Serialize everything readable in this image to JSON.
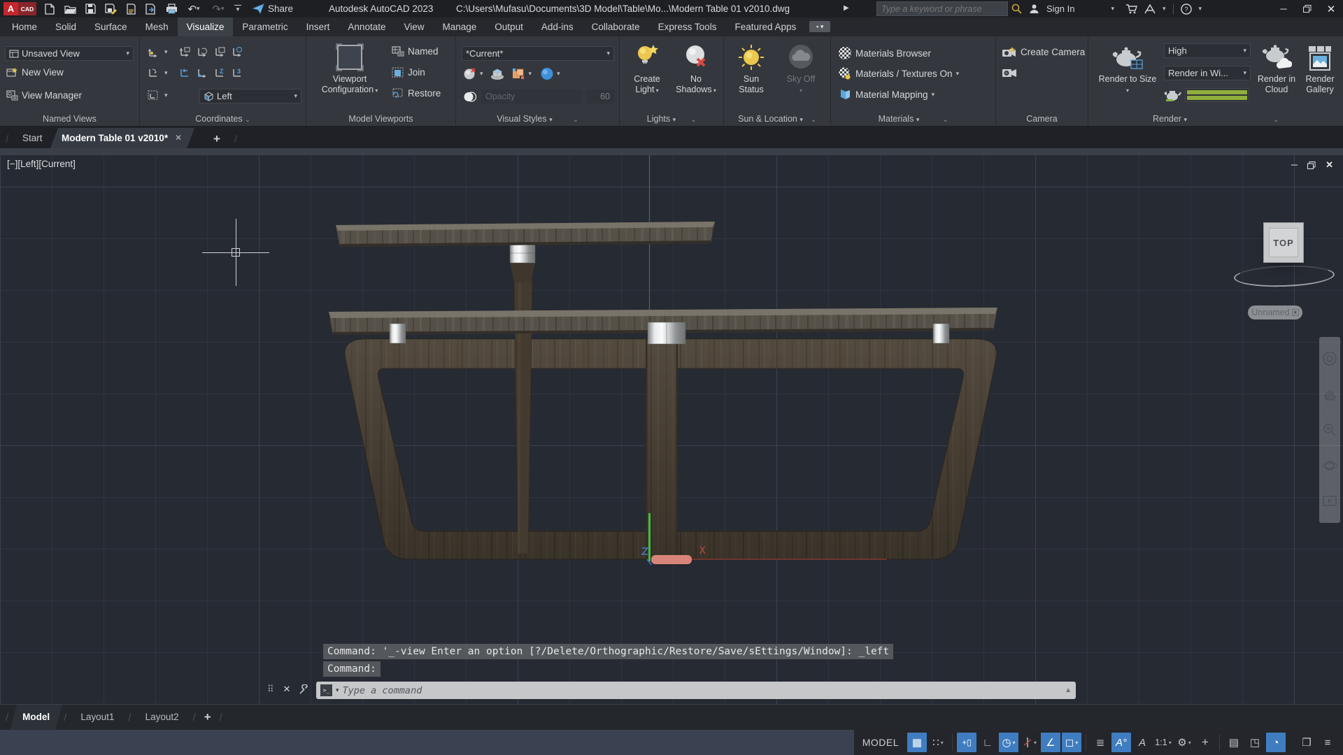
{
  "titlebar": {
    "app_title": "Autodesk AutoCAD 2023",
    "file_path": "C:\\Users\\Mufasu\\Documents\\3D Model\\Table\\Mo...\\Modern Table 01 v2010.dwg",
    "share": "Share",
    "search_placeholder": "Type a keyword or phrase",
    "sign_in": "Sign In"
  },
  "ribbon_tabs": [
    "Home",
    "Solid",
    "Surface",
    "Mesh",
    "Visualize",
    "Parametric",
    "Insert",
    "Annotate",
    "View",
    "Manage",
    "Output",
    "Add-ins",
    "Collaborate",
    "Express Tools",
    "Featured Apps"
  ],
  "ribbon": {
    "named_views": {
      "title": "Named Views",
      "view_dropdown": "Unsaved View",
      "new_view": "New View",
      "view_manager": "View Manager"
    },
    "coordinates": {
      "title": "Coordinates",
      "view": "Left"
    },
    "model_viewports": {
      "title": "Model Viewports",
      "config1": "Viewport",
      "config2": "Configuration",
      "named": "Named",
      "join": "Join",
      "restore": "Restore"
    },
    "visual_styles": {
      "title": "Visual Styles",
      "style": "*Current*",
      "opacity": "Opacity",
      "opacity_value": "60"
    },
    "lights": {
      "title": "Lights",
      "create1": "Create",
      "create2": "Light",
      "nosh1": "No",
      "nosh2": "Shadows"
    },
    "sun": {
      "title": "Sun & Location",
      "sun1": "Sun",
      "sun2": "Status",
      "sky": "Sky Off"
    },
    "materials": {
      "title": "Materials",
      "browser": "Materials Browser",
      "textures": "Materials / Textures On",
      "mapping": "Material Mapping"
    },
    "camera": {
      "title": "Camera",
      "create": "Create Camera"
    },
    "render": {
      "title": "Render",
      "to_size": "Render to Size",
      "quality": "High",
      "target": "Render in Wi...",
      "cloud1": "Render in",
      "cloud2": "Cloud",
      "gal1": "Render",
      "gal2": "Gallery"
    }
  },
  "file_tabs": {
    "start": "Start",
    "doc": "Modern Table 01 v2010*"
  },
  "viewport": {
    "label": "[−][Left][Current]",
    "viewcube": "TOP",
    "pill": "Unnamed"
  },
  "command": {
    "line1": "Command: '_-view Enter an option [?/Delete/Orthographic/Restore/Save/sEttings/Window]: _left",
    "line2": "Command:",
    "placeholder": "Type a command"
  },
  "layout_tabs": {
    "model": "Model",
    "l1": "Layout1",
    "l2": "Layout2"
  },
  "status": {
    "model": "MODEL",
    "scale": "1:1"
  }
}
